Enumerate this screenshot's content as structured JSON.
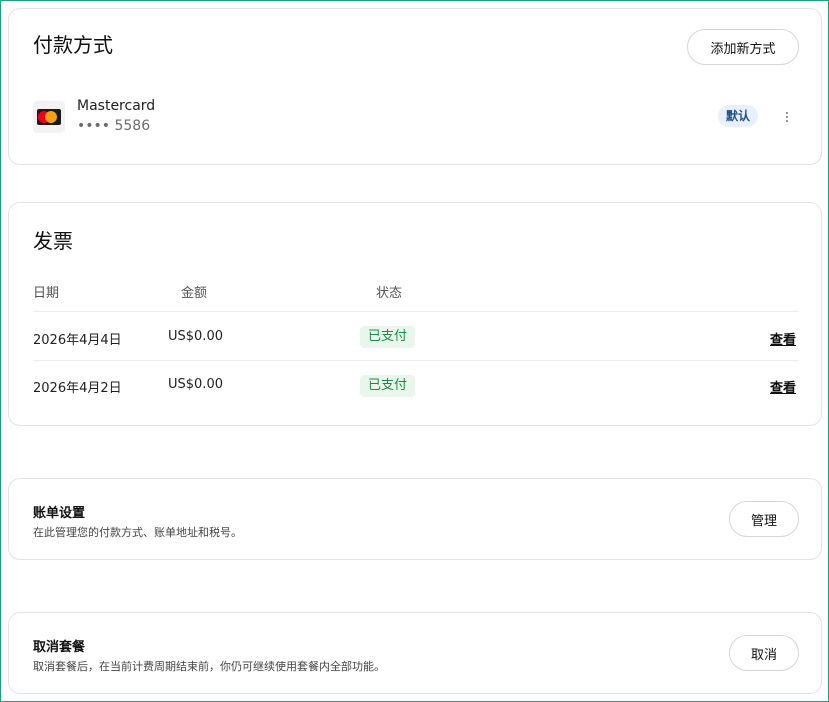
{
  "payment": {
    "title": "付款方式",
    "add_button": "添加新方式",
    "card": {
      "icon": "mastercard-icon",
      "brand": "Mastercard",
      "last4": "•••• 5586",
      "badge": "默认"
    }
  },
  "invoices": {
    "title": "发票",
    "columns": {
      "date": "日期",
      "amount": "金额",
      "status": "状态"
    },
    "rows": [
      {
        "date": "2026年4月4日",
        "amount": "US$0.00",
        "status": "已支付",
        "action": "查看"
      },
      {
        "date": "2026年4月2日",
        "amount": "US$0.00",
        "status": "已支付",
        "action": "查看"
      }
    ]
  },
  "billing_settings": {
    "title": "账单设置",
    "description": "在此管理您的付款方式、账单地址和税号。",
    "button": "管理"
  },
  "cancel_plan": {
    "title": "取消套餐",
    "description": "取消套餐后，在当前计费周期结束前，你仍可继续使用套餐内全部功能。",
    "button": "取消"
  },
  "colors": {
    "accent_border": "#1aa37a",
    "paid_bg": "#e8f6ec",
    "paid_text": "#1e8a46",
    "default_badge_bg": "#e7f0fb",
    "default_badge_text": "#1d4f91"
  }
}
